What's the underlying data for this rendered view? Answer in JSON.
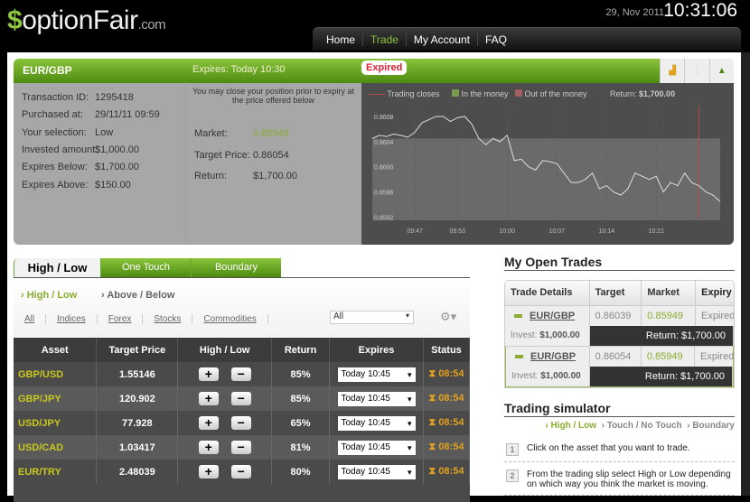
{
  "header": {
    "logo": "optionFair.com",
    "logo_main": "optionFair",
    "logo_suffix": ".com",
    "date": "29, Nov 2011",
    "time": "10:31:06",
    "nav": [
      {
        "label": "Home"
      },
      {
        "label": "Trade",
        "active": true
      },
      {
        "label": "My Account"
      },
      {
        "label": "FAQ"
      }
    ]
  },
  "trade_panel": {
    "asset": "EUR/GBP",
    "expires": "Expires:  Today 10:30",
    "status": "Expired",
    "details": [
      {
        "label": "Transaction ID:",
        "value": "1295418"
      },
      {
        "label": "Purchased at:",
        "value": "29/11/11 09:59"
      },
      {
        "label": "Your selection:",
        "value": "Low"
      },
      {
        "label": "Invested amount:",
        "value": "$1,000.00"
      },
      {
        "label": "Expires Below:",
        "value": "$1,700.00"
      },
      {
        "label": "Expires Above:",
        "value": "$150.00"
      }
    ],
    "note": "You may close your position prior to expiry at the price offered below",
    "market_label": "Market:",
    "market": "0.85949",
    "target_label": "Target Price:",
    "target": "0.86054",
    "return_label": "Return:",
    "return": "$1,700.00"
  },
  "chart_data": {
    "type": "line",
    "legend": [
      "Trading closes",
      "In the money",
      "Out of the money"
    ],
    "return_label": "Return:",
    "return_value": "$1,700.00",
    "y_ticks": [
      "0.8608",
      "0.8604",
      "0.8600",
      "0.8596",
      "0.8592"
    ],
    "ylim": [
      0.85915,
      0.8609
    ],
    "x_ticks": [
      "09:47",
      "09:53",
      "10:00",
      "10:07",
      "10:14",
      "10:21"
    ],
    "xlim": [
      "09:41",
      "10:30"
    ],
    "target": 0.86045,
    "trading_closes": "10:27",
    "colors": {
      "line": "#dddddd",
      "closes": "#b05040",
      "money": "#6a6a6a"
    },
    "series": [
      [
        "09:41",
        0.86045
      ],
      [
        "09:42",
        0.8605
      ],
      [
        "09:43",
        0.86048
      ],
      [
        "09:44",
        0.86052
      ],
      [
        "09:45",
        0.8605
      ],
      [
        "09:46",
        0.86047
      ],
      [
        "09:47",
        0.86055
      ],
      [
        "09:48",
        0.8607
      ],
      [
        "09:49",
        0.86075
      ],
      [
        "09:50",
        0.8608
      ],
      [
        "09:51",
        0.8608
      ],
      [
        "09:52",
        0.86072
      ],
      [
        "09:53",
        0.86078
      ],
      [
        "09:54",
        0.8608
      ],
      [
        "09:55",
        0.86068
      ],
      [
        "09:56",
        0.86045
      ],
      [
        "09:57",
        0.86035
      ],
      [
        "09:58",
        0.86045
      ],
      [
        "09:59",
        0.8604
      ],
      [
        "10:00",
        0.8605
      ],
      [
        "10:01",
        0.8601
      ],
      [
        "10:02",
        0.86012
      ],
      [
        "10:03",
        0.86
      ],
      [
        "10:04",
        0.85995
      ],
      [
        "10:05",
        0.8601
      ],
      [
        "10:06",
        0.86008
      ],
      [
        "10:07",
        0.86005
      ],
      [
        "10:08",
        0.8599
      ],
      [
        "10:09",
        0.85975
      ],
      [
        "10:10",
        0.85975
      ],
      [
        "10:11",
        0.8598
      ],
      [
        "10:12",
        0.8599
      ],
      [
        "10:13",
        0.85965
      ],
      [
        "10:14",
        0.8597
      ],
      [
        "10:15",
        0.8596
      ],
      [
        "10:16",
        0.85955
      ],
      [
        "10:17",
        0.85965
      ],
      [
        "10:18",
        0.8599
      ],
      [
        "10:19",
        0.85985
      ],
      [
        "10:20",
        0.8598
      ],
      [
        "10:21",
        0.85985
      ],
      [
        "10:22",
        0.8596
      ],
      [
        "10:23",
        0.85975
      ],
      [
        "10:24",
        0.8597
      ],
      [
        "10:25",
        0.8599
      ],
      [
        "10:26",
        0.85975
      ],
      [
        "10:27",
        0.8597
      ],
      [
        "10:28",
        0.8596
      ],
      [
        "10:29",
        0.85955
      ],
      [
        "10:30",
        0.85945
      ]
    ]
  },
  "left": {
    "tabs": [
      "High / Low",
      "One Touch",
      "Boundary"
    ],
    "subtabs": [
      "High / Low",
      "Above / Below"
    ],
    "categories": [
      "All",
      "Indices",
      "Forex",
      "Stocks",
      "Commodities"
    ],
    "filter_select": "All",
    "columns": [
      "Asset",
      "Target Price",
      "High / Low",
      "Return",
      "Expires",
      "Status"
    ],
    "rows": [
      {
        "asset": "GBP/USD",
        "price": "1.55146",
        "ret": "85%",
        "exp": "Today 10:45",
        "status": "08:54"
      },
      {
        "asset": "GBP/JPY",
        "price": "120.902",
        "ret": "85%",
        "exp": "Today 10:45",
        "status": "08:54"
      },
      {
        "asset": "USD/JPY",
        "price": "77.928",
        "ret": "65%",
        "exp": "Today 10:45",
        "status": "08:54"
      },
      {
        "asset": "USD/CAD",
        "price": "1.03417",
        "ret": "81%",
        "exp": "Today 10:45",
        "status": "08:54"
      },
      {
        "asset": "EUR/TRY",
        "price": "2.48039",
        "ret": "80%",
        "exp": "Today 10:45",
        "status": "08:54"
      }
    ]
  },
  "right": {
    "title": "My Open Trades",
    "columns": [
      "Trade Details",
      "Target",
      "Market",
      "Expiry"
    ],
    "trades": [
      {
        "asset": "EUR/GBP",
        "target": "0.86039",
        "market": "0.85949",
        "expiry": "Expired",
        "invest_label": "Invest:",
        "invest": "$1,000.00",
        "return": "Return: $1,700.00"
      },
      {
        "asset": "EUR/GBP",
        "target": "0.86054",
        "market": "0.85949",
        "expiry": "Expired",
        "invest_label": "Invest:",
        "invest": "$1,000.00",
        "return": "Return: $1,700.00"
      }
    ],
    "sim_title": "Trading simulator",
    "sim_tabs": [
      "High / Low",
      "Touch / No Touch",
      "Boundary"
    ],
    "steps": [
      {
        "n": "1",
        "text": "Click on the asset that you want to trade."
      },
      {
        "n": "2",
        "text": "From the trading slip select High or  Low depending on which way you think the market is moving."
      }
    ]
  }
}
